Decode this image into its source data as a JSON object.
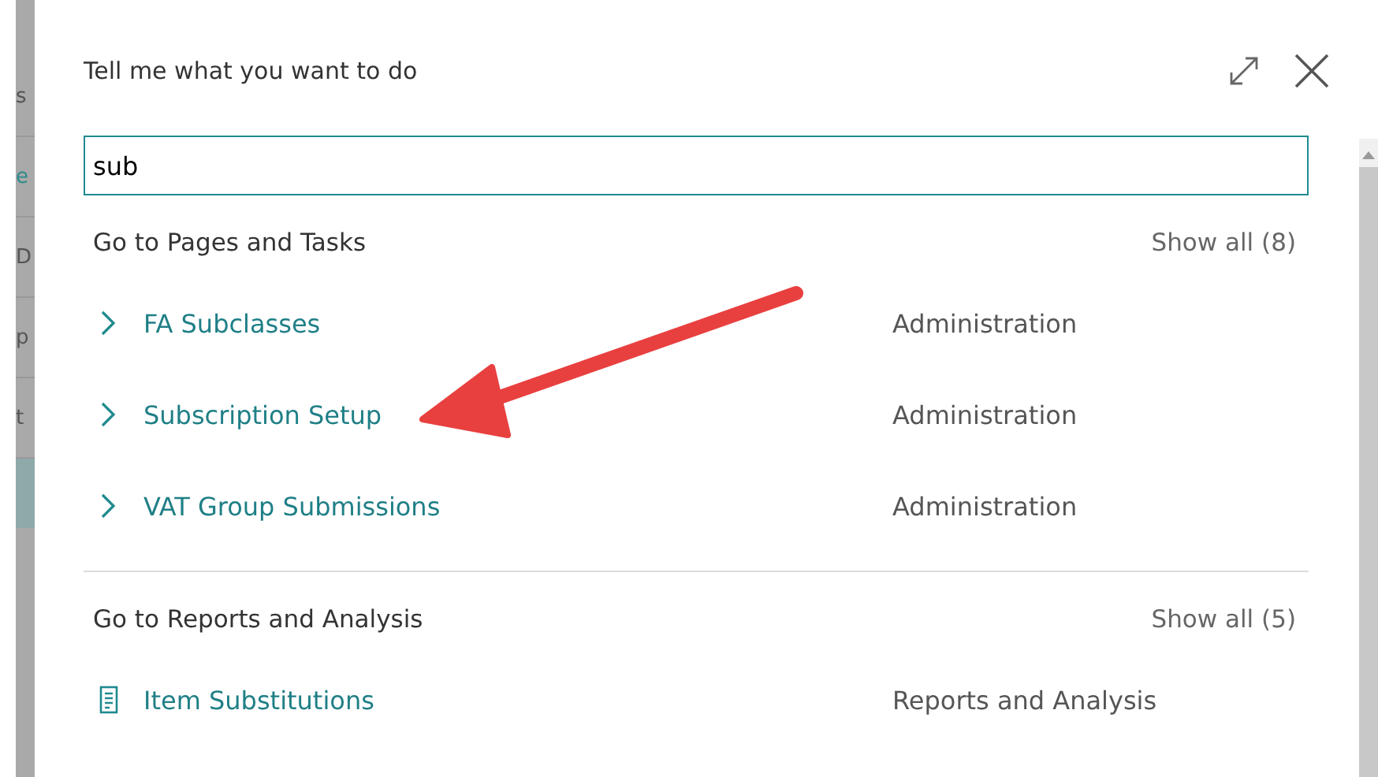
{
  "background_fragments": [
    {
      "text": "s",
      "kind": "plain"
    },
    {
      "text": "e",
      "kind": "link"
    },
    {
      "text": "D",
      "kind": "plain"
    },
    {
      "text": "p",
      "kind": "plain"
    },
    {
      "text": "t",
      "kind": "plain"
    }
  ],
  "dialog": {
    "title": "Tell me what you want to do"
  },
  "search": {
    "value": "sub"
  },
  "sections": [
    {
      "heading": "Go to Pages and Tasks",
      "show_all": "Show all (8)",
      "items": [
        {
          "kind": "page",
          "label": "FA Subclasses",
          "category": "Administration"
        },
        {
          "kind": "page",
          "label": "Subscription Setup",
          "category": "Administration"
        },
        {
          "kind": "page",
          "label": "VAT Group Submissions",
          "category": "Administration"
        }
      ]
    },
    {
      "heading": "Go to Reports and Analysis",
      "show_all": "Show all (5)",
      "items": [
        {
          "kind": "report",
          "label": "Item Substitutions",
          "category": "Reports and Analysis"
        }
      ]
    }
  ]
}
